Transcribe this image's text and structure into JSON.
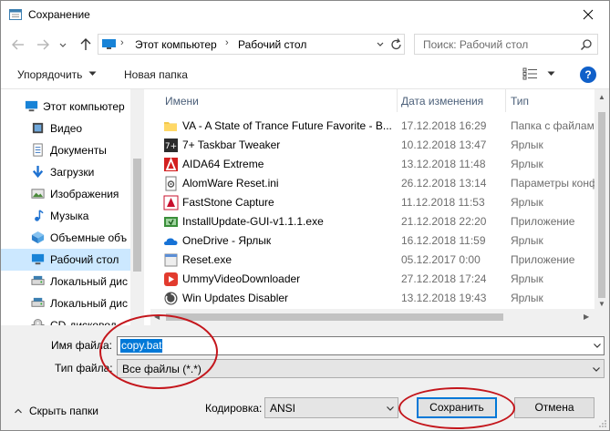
{
  "window": {
    "title": "Сохранение"
  },
  "nav": {
    "breadcrumbs": [
      "Этот компьютер",
      "Рабочий стол"
    ],
    "search_placeholder": "Поиск: Рабочий стол"
  },
  "toolbar": {
    "organize_label": "Упорядочить",
    "new_folder_label": "Новая папка",
    "help_label": "?"
  },
  "sidebar": {
    "items": [
      {
        "label": "Этот компьютер",
        "icon": "computer-icon"
      },
      {
        "label": "Видео",
        "icon": "video-icon"
      },
      {
        "label": "Документы",
        "icon": "documents-icon"
      },
      {
        "label": "Загрузки",
        "icon": "downloads-icon"
      },
      {
        "label": "Изображения",
        "icon": "pictures-icon"
      },
      {
        "label": "Музыка",
        "icon": "music-icon"
      },
      {
        "label": "Объемные объ",
        "icon": "3d-objects-icon"
      },
      {
        "label": "Рабочий стол",
        "icon": "desktop-icon",
        "selected": true
      },
      {
        "label": "Локальный дис",
        "icon": "drive-icon"
      },
      {
        "label": "Локальный дис",
        "icon": "drive-icon"
      },
      {
        "label": "CD-дисковод",
        "icon": "cd-drive-icon"
      }
    ]
  },
  "files": {
    "columns": [
      "Имени",
      "Дата изменения",
      "Тип"
    ],
    "rows": [
      {
        "name": "VA - A State of Trance Future Favorite - B...",
        "date": "17.12.2018 16:29",
        "type": "Папка с файлами",
        "icon": "folder-icon"
      },
      {
        "name": "7+ Taskbar Tweaker",
        "date": "10.12.2018 13:47",
        "type": "Ярлык",
        "icon": "taskbar-tweaker-icon"
      },
      {
        "name": "AIDA64 Extreme",
        "date": "13.12.2018 11:48",
        "type": "Ярлык",
        "icon": "aida64-icon"
      },
      {
        "name": "AlomWare Reset.ini",
        "date": "26.12.2018 13:14",
        "type": "Параметры конфигурации",
        "icon": "settings-file-icon"
      },
      {
        "name": "FastStone Capture",
        "date": "11.12.2018 11:53",
        "type": "Ярлык",
        "icon": "faststone-icon"
      },
      {
        "name": "InstallUpdate-GUI-v1.1.1.exe",
        "date": "21.12.2018 22:20",
        "type": "Приложение",
        "icon": "installer-icon"
      },
      {
        "name": "OneDrive - Ярлык",
        "date": "16.12.2018 11:59",
        "type": "Ярлык",
        "icon": "onedrive-icon"
      },
      {
        "name": "Reset.exe",
        "date": "05.12.2017 0:00",
        "type": "Приложение",
        "icon": "reset-exe-icon"
      },
      {
        "name": "UmmyVideoDownloader",
        "date": "27.12.2018 17:24",
        "type": "Ярлык",
        "icon": "ummy-icon"
      },
      {
        "name": "Win Updates Disabler",
        "date": "13.12.2018 19:43",
        "type": "Ярлык",
        "icon": "win-updates-icon"
      }
    ]
  },
  "form": {
    "filename_label": "Имя файла:",
    "filename_value": "copy.bat",
    "filetype_label": "Тип файла:",
    "filetype_value": "Все файлы  (*.*)",
    "encoding_label": "Кодировка:",
    "encoding_value": "ANSI"
  },
  "footer": {
    "hide_folders_label": "Скрыть папки",
    "save_label": "Сохранить",
    "cancel_label": "Отмена"
  },
  "colors": {
    "accent": "#0078d7",
    "selection": "#cce8ff",
    "annotation": "#c4161c"
  }
}
